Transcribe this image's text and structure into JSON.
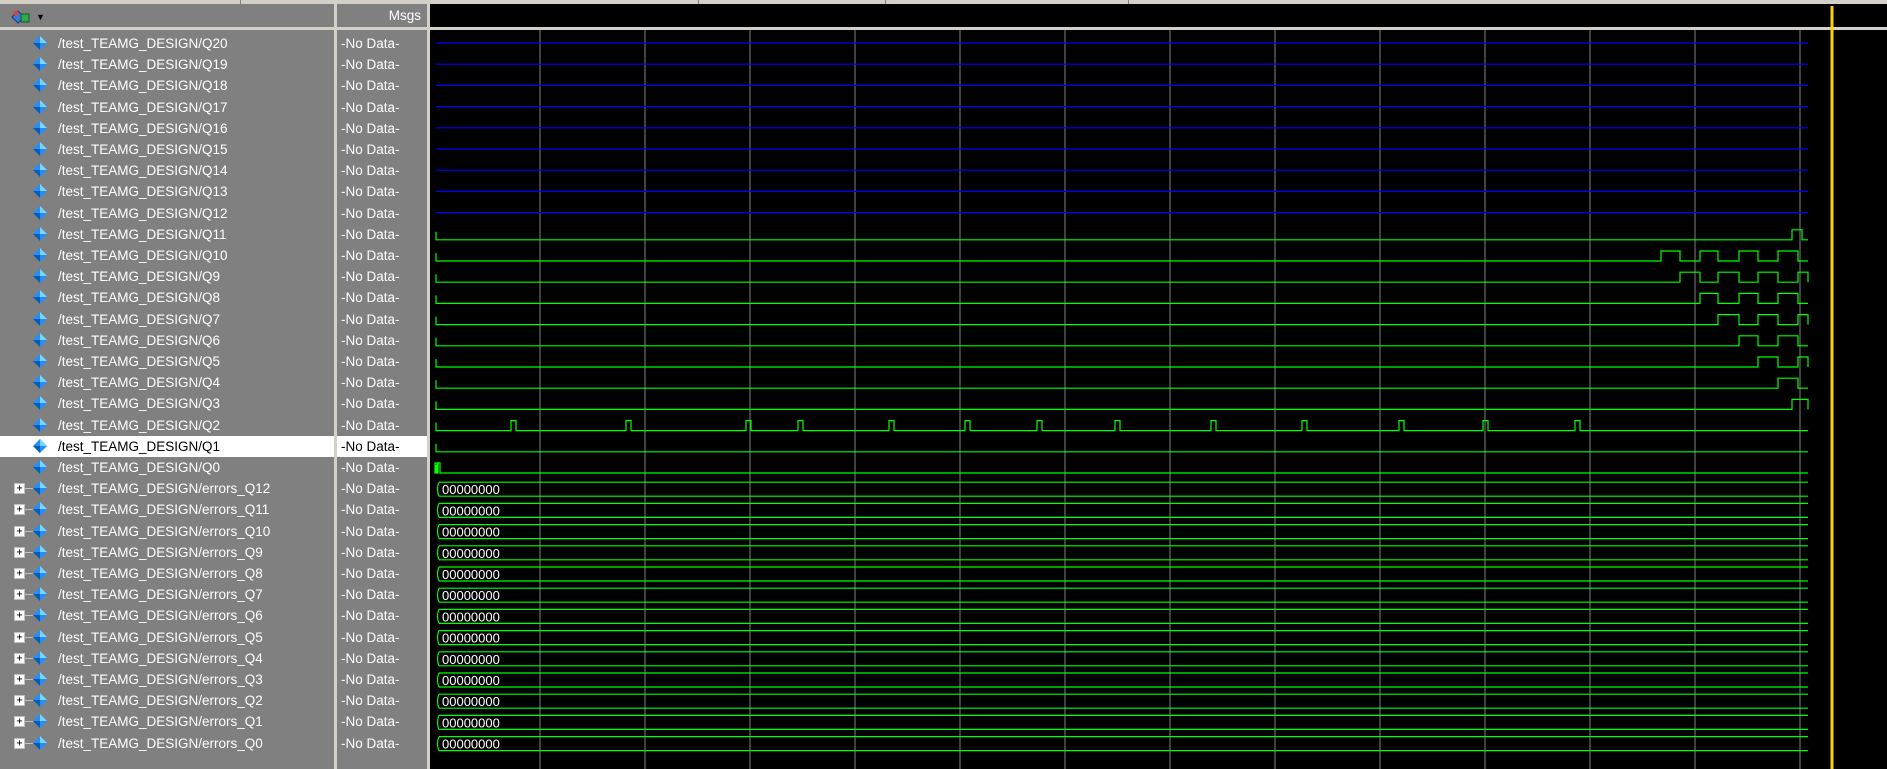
{
  "header": {
    "menu_icon": "wave-tools-icon",
    "msgs_label": "Msgs"
  },
  "colors": {
    "panel": "#808080",
    "wave_bg": "#000000",
    "grid": "#808080",
    "digital": "#00ff00",
    "hiz": "#0000ff",
    "cursor": "#ffd000",
    "selected_row": "#ffffff"
  },
  "signals": [
    {
      "name": "/test_TEAMG_DESIGN/Q20",
      "value": "-No Data-",
      "bus": false
    },
    {
      "name": "/test_TEAMG_DESIGN/Q19",
      "value": "-No Data-",
      "bus": false
    },
    {
      "name": "/test_TEAMG_DESIGN/Q18",
      "value": "-No Data-",
      "bus": false
    },
    {
      "name": "/test_TEAMG_DESIGN/Q17",
      "value": "-No Data-",
      "bus": false
    },
    {
      "name": "/test_TEAMG_DESIGN/Q16",
      "value": "-No Data-",
      "bus": false
    },
    {
      "name": "/test_TEAMG_DESIGN/Q15",
      "value": "-No Data-",
      "bus": false
    },
    {
      "name": "/test_TEAMG_DESIGN/Q14",
      "value": "-No Data-",
      "bus": false
    },
    {
      "name": "/test_TEAMG_DESIGN/Q13",
      "value": "-No Data-",
      "bus": false
    },
    {
      "name": "/test_TEAMG_DESIGN/Q12",
      "value": "-No Data-",
      "bus": false
    },
    {
      "name": "/test_TEAMG_DESIGN/Q11",
      "value": "-No Data-",
      "bus": false
    },
    {
      "name": "/test_TEAMG_DESIGN/Q10",
      "value": "-No Data-",
      "bus": false
    },
    {
      "name": "/test_TEAMG_DESIGN/Q9",
      "value": "-No Data-",
      "bus": false
    },
    {
      "name": "/test_TEAMG_DESIGN/Q8",
      "value": "-No Data-",
      "bus": false
    },
    {
      "name": "/test_TEAMG_DESIGN/Q7",
      "value": "-No Data-",
      "bus": false
    },
    {
      "name": "/test_TEAMG_DESIGN/Q6",
      "value": "-No Data-",
      "bus": false
    },
    {
      "name": "/test_TEAMG_DESIGN/Q5",
      "value": "-No Data-",
      "bus": false
    },
    {
      "name": "/test_TEAMG_DESIGN/Q4",
      "value": "-No Data-",
      "bus": false
    },
    {
      "name": "/test_TEAMG_DESIGN/Q3",
      "value": "-No Data-",
      "bus": false
    },
    {
      "name": "/test_TEAMG_DESIGN/Q2",
      "value": "-No Data-",
      "bus": false
    },
    {
      "name": "/test_TEAMG_DESIGN/Q1",
      "value": "-No Data-",
      "bus": false,
      "selected": true
    },
    {
      "name": "/test_TEAMG_DESIGN/Q0",
      "value": "-No Data-",
      "bus": false
    },
    {
      "name": "/test_TEAMG_DESIGN/errors_Q12",
      "value": "-No Data-",
      "bus": true,
      "bus_value": "00000000"
    },
    {
      "name": "/test_TEAMG_DESIGN/errors_Q11",
      "value": "-No Data-",
      "bus": true,
      "bus_value": "00000000"
    },
    {
      "name": "/test_TEAMG_DESIGN/errors_Q10",
      "value": "-No Data-",
      "bus": true,
      "bus_value": "00000000"
    },
    {
      "name": "/test_TEAMG_DESIGN/errors_Q9",
      "value": "-No Data-",
      "bus": true,
      "bus_value": "00000000"
    },
    {
      "name": "/test_TEAMG_DESIGN/errors_Q8",
      "value": "-No Data-",
      "bus": true,
      "bus_value": "00000000"
    },
    {
      "name": "/test_TEAMG_DESIGN/errors_Q7",
      "value": "-No Data-",
      "bus": true,
      "bus_value": "00000000"
    },
    {
      "name": "/test_TEAMG_DESIGN/errors_Q6",
      "value": "-No Data-",
      "bus": true,
      "bus_value": "00000000"
    },
    {
      "name": "/test_TEAMG_DESIGN/errors_Q5",
      "value": "-No Data-",
      "bus": true,
      "bus_value": "00000000"
    },
    {
      "name": "/test_TEAMG_DESIGN/errors_Q4",
      "value": "-No Data-",
      "bus": true,
      "bus_value": "00000000"
    },
    {
      "name": "/test_TEAMG_DESIGN/errors_Q3",
      "value": "-No Data-",
      "bus": true,
      "bus_value": "00000000"
    },
    {
      "name": "/test_TEAMG_DESIGN/errors_Q2",
      "value": "-No Data-",
      "bus": true,
      "bus_value": "00000000"
    },
    {
      "name": "/test_TEAMG_DESIGN/errors_Q1",
      "value": "-No Data-",
      "bus": true,
      "bus_value": "00000000"
    },
    {
      "name": "/test_TEAMG_DESIGN/errors_Q0",
      "value": "-No Data-",
      "bus": true,
      "bus_value": "00000000"
    }
  ]
}
